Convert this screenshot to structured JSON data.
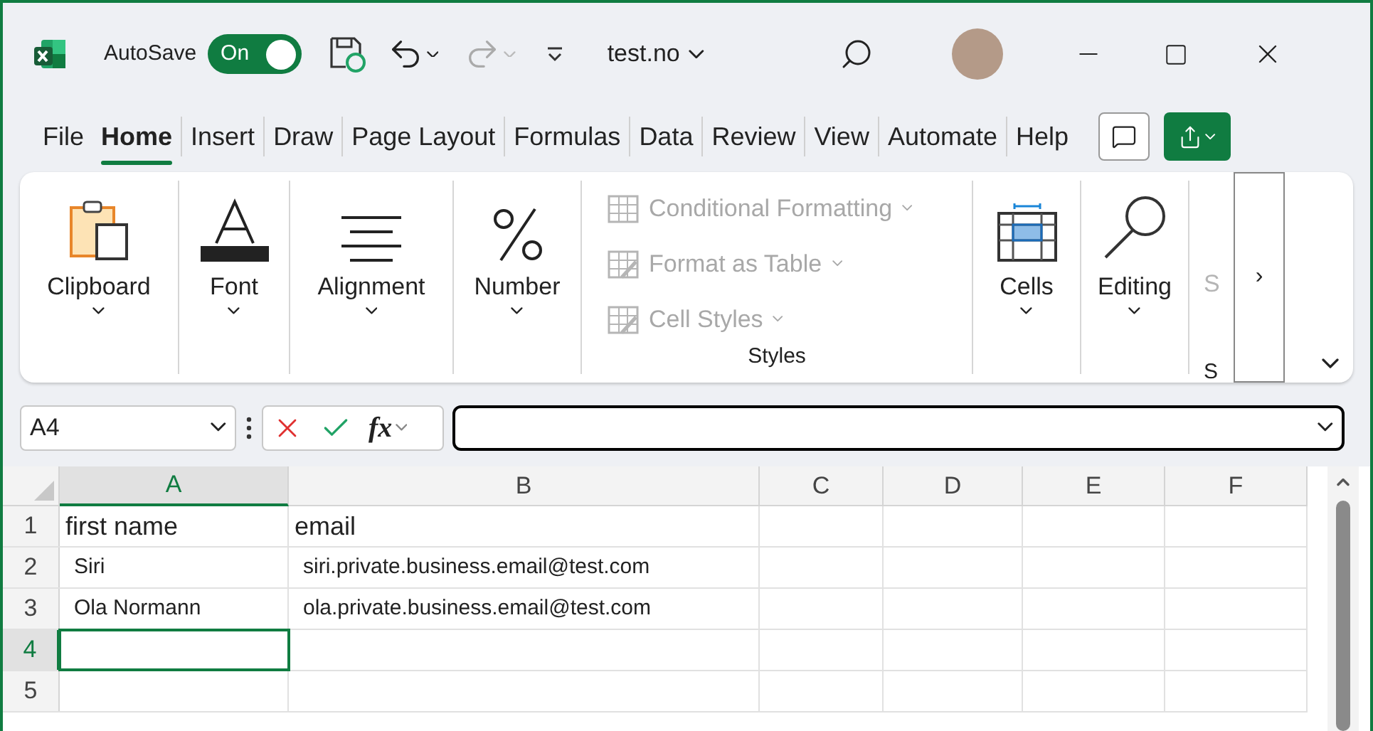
{
  "title_bar": {
    "autosave_label": "AutoSave",
    "autosave": {
      "on": true,
      "label": "On"
    },
    "file_name": "test.no"
  },
  "tabs": [
    {
      "label": "File",
      "selected": false
    },
    {
      "label": "Home",
      "selected": true
    },
    {
      "label": "Insert",
      "selected": false
    },
    {
      "label": "Draw",
      "selected": false
    },
    {
      "label": "Page Layout",
      "selected": false
    },
    {
      "label": "Formulas",
      "selected": false
    },
    {
      "label": "Data",
      "selected": false
    },
    {
      "label": "Review",
      "selected": false
    },
    {
      "label": "View",
      "selected": false
    },
    {
      "label": "Automate",
      "selected": false
    },
    {
      "label": "Help",
      "selected": false
    }
  ],
  "ribbon": {
    "groups": [
      {
        "kind": "large",
        "label": "Clipboard"
      },
      {
        "kind": "large",
        "label": "Font"
      },
      {
        "kind": "large",
        "label": "Alignment"
      },
      {
        "kind": "large",
        "label": "Number"
      },
      {
        "kind": "list",
        "label": "Styles",
        "items": [
          {
            "label": "Conditional Formatting",
            "disabled": true
          },
          {
            "label": "Format as Table",
            "disabled": true
          },
          {
            "label": "Cell Styles",
            "disabled": true
          }
        ]
      },
      {
        "kind": "large",
        "label": "Cells"
      },
      {
        "kind": "large",
        "label": "Editing"
      },
      {
        "kind": "partial",
        "label": "S",
        "group_label": "S"
      }
    ],
    "overflow": "›"
  },
  "formula_bar": {
    "name_box": "A4",
    "fx": "fx"
  },
  "sheet": {
    "columns": [
      {
        "label": "A",
        "selected": true
      },
      {
        "label": "B",
        "selected": false
      },
      {
        "label": "C",
        "selected": false
      },
      {
        "label": "D",
        "selected": false
      },
      {
        "label": "E",
        "selected": false
      },
      {
        "label": "F",
        "selected": false
      }
    ],
    "rows": [
      {
        "number": "1",
        "selected": false,
        "cells": [
          "first name",
          "email",
          "",
          "",
          "",
          ""
        ]
      },
      {
        "number": "2",
        "selected": false,
        "cells": [
          "Siri",
          "siri.private.business.email@test.com",
          "",
          "",
          "",
          ""
        ]
      },
      {
        "number": "3",
        "selected": false,
        "cells": [
          "Ola Normann",
          "ola.private.business.email@test.com",
          "",
          "",
          "",
          ""
        ]
      },
      {
        "number": "4",
        "selected": true,
        "cells": [
          "",
          "",
          "",
          "",
          "",
          ""
        ]
      },
      {
        "number": "5",
        "selected": false,
        "cells": [
          "",
          "",
          "",
          "",
          "",
          ""
        ]
      }
    ]
  }
}
